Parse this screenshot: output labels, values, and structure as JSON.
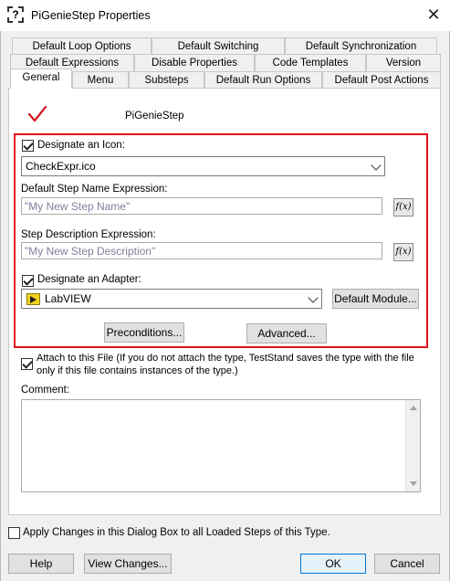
{
  "window": {
    "title": "PiGenieStep Properties"
  },
  "tabs": {
    "row1": [
      "Default Loop Options",
      "Default Switching",
      "Default Synchronization"
    ],
    "row2": [
      "Default Expressions",
      "Disable Properties",
      "Code Templates",
      "Version"
    ],
    "row3": [
      "General",
      "Menu",
      "Substeps",
      "Default Run Options",
      "Default Post Actions"
    ],
    "active": "General"
  },
  "general": {
    "step_name": "PiGenieStep",
    "designate_icon_label": "Designate an Icon:",
    "designate_icon_checked": true,
    "icon_value": "CheckExpr.ico",
    "default_name_label": "Default Step Name Expression:",
    "default_name_value": "\"My New Step Name\"",
    "description_label": "Step Description Expression:",
    "description_value": "\"My New Step Description\"",
    "fx_label": "f(x)",
    "designate_adapter_label": "Designate an Adapter:",
    "designate_adapter_checked": true,
    "adapter_value": "LabVIEW",
    "default_module_button": "Default Module...",
    "preconditions_button": "Preconditions...",
    "advanced_button": "Advanced...",
    "attach_label_line1": "Attach to this File (If you do not attach the type, TestStand saves the type with the file",
    "attach_label_line2": "only if this file contains instances of the type.)",
    "attach_checked": true,
    "comment_label": "Comment:",
    "comment_value": ""
  },
  "footer": {
    "apply_label": "Apply Changes in this Dialog Box to all Loaded Steps of this Type.",
    "apply_checked": false,
    "help": "Help",
    "view_changes": "View Changes...",
    "ok": "OK",
    "cancel": "Cancel"
  },
  "colors": {
    "highlight_box": "#e3121b",
    "check_mark": "#d0101a",
    "ok_border": "#0078d7"
  },
  "icons": {
    "title": "step-type-dashed-icon",
    "close": "close-icon",
    "adapter": "labview-adapter-icon",
    "marker": "red-check-icon"
  }
}
